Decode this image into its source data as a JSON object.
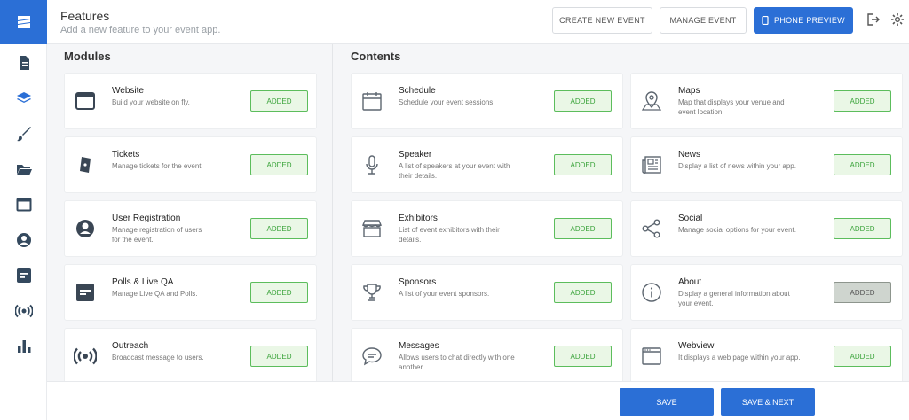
{
  "header": {
    "title": "Features",
    "subtitle": "Add a new feature to your event app.",
    "create_event": "CREATE NEW EVENT",
    "manage_event": "MANAGE EVENT",
    "phone_preview": "PHONE PREVIEW"
  },
  "modules": {
    "title": "Modules",
    "items": [
      {
        "title": "Website",
        "desc": "Build your website on fly.",
        "status": "ADDED"
      },
      {
        "title": "Tickets",
        "desc": "Manage tickets for the event.",
        "status": "ADDED"
      },
      {
        "title": "User Registration",
        "desc": "Manage registration of users for the event.",
        "status": "ADDED"
      },
      {
        "title": "Polls & Live QA",
        "desc": "Manage Live QA and Polls.",
        "status": "ADDED"
      },
      {
        "title": "Outreach",
        "desc": "Broadcast message to users.",
        "status": "ADDED"
      }
    ]
  },
  "contents": {
    "title": "Contents",
    "left": [
      {
        "title": "Schedule",
        "desc": "Schedule your event sessions.",
        "status": "ADDED"
      },
      {
        "title": "Speaker",
        "desc": "A list of speakers at your event with their details.",
        "status": "ADDED"
      },
      {
        "title": "Exhibitors",
        "desc": "List of event exhibitors with their details.",
        "status": "ADDED"
      },
      {
        "title": "Sponsors",
        "desc": "A list of your event sponsors.",
        "status": "ADDED"
      },
      {
        "title": "Messages",
        "desc": "Allows users to chat directly with one another.",
        "status": "ADDED"
      }
    ],
    "right": [
      {
        "title": "Maps",
        "desc": "Map that displays your venue and event location.",
        "status": "ADDED"
      },
      {
        "title": "News",
        "desc": "Display a list of news within your app.",
        "status": "ADDED"
      },
      {
        "title": "Social",
        "desc": "Manage social options for your event.",
        "status": "ADDED"
      },
      {
        "title": "About",
        "desc": "Display a general information about your event.",
        "status": "ADDED"
      },
      {
        "title": "Webview",
        "desc": "It displays a web page within your app.",
        "status": "ADDED"
      }
    ]
  },
  "footer": {
    "save": "SAVE",
    "save_next": "SAVE & NEXT"
  },
  "colors": {
    "brand": "#2b6fd6",
    "added_border": "#5cbd5c",
    "added_bg": "#eaf7e6",
    "added_text": "#3aa33a"
  }
}
